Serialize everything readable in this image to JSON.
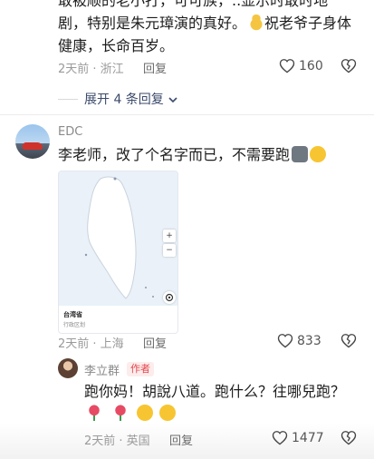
{
  "comment_top": {
    "line1": "敢被顺的老小打，可可族，..显示时敢时地",
    "line2": "剧，特别是朱元璋演的真好。",
    "line2_tail": "祝老爷子身体",
    "line3": "健康，长命百岁。",
    "time_location": "2天前 · 浙江",
    "reply_label": "回复",
    "like_count": "160",
    "expand_label": "展开 4 条回复"
  },
  "comment_edc": {
    "username": "EDC",
    "text": "李老师，改了个名字而已，不需要跑",
    "map_card": {
      "title": "台湾省",
      "subtitle": "行政区划",
      "zoom_in": "+",
      "zoom_out": "−"
    },
    "time_location": "2天前 · 上海",
    "reply_label": "回复",
    "like_count": "833"
  },
  "comment_li": {
    "username": "李立群",
    "badge": "作者",
    "text": "跑你妈！胡說八道。跑什么？往哪兒跑？",
    "time_location": "2天前 · 英国",
    "reply_label": "回复",
    "like_count": "1477"
  },
  "icons": {
    "like": "heart-outline-icon",
    "dislike": "broken-heart-icon",
    "expand": "chevron-down-icon"
  },
  "colors": {
    "text": "#1c1c1c",
    "meta": "#9a9a9a",
    "expand": "#3b4a6b",
    "author_badge": "#e5484d"
  }
}
